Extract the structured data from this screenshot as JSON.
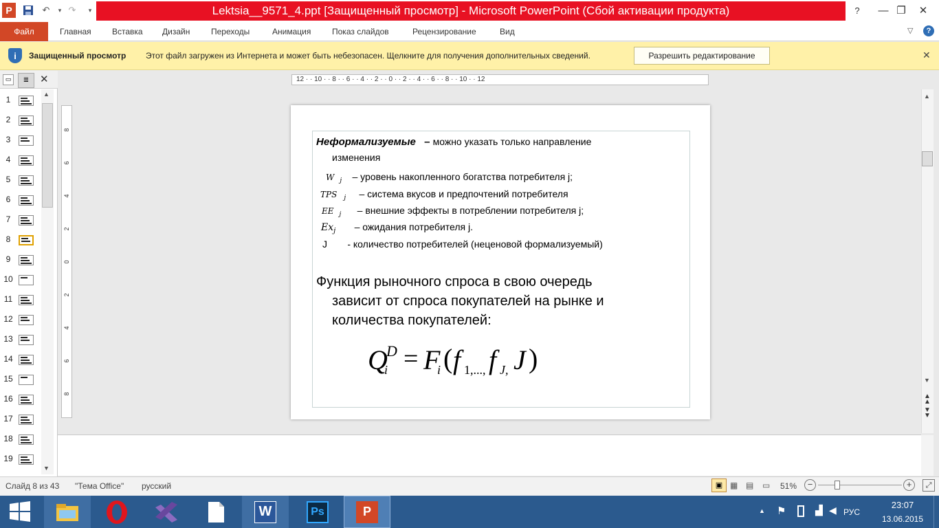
{
  "window": {
    "title": "Lektsia__9571_4.ppt [Защищенный просмотр] - Microsoft PowerPoint (Сбой активации продукта)",
    "app_icon": "P"
  },
  "ribbon": {
    "file_tab": "Файл",
    "tabs": [
      "Главная",
      "Вставка",
      "Дизайн",
      "Переходы",
      "Анимация",
      "Показ слайдов",
      "Рецензирование",
      "Вид"
    ]
  },
  "protected": {
    "title": "Защищенный просмотр",
    "message": "Этот файл загружен из Интернета и может быть небезопасен. Щелкните для получения дополнительных сведений.",
    "button": "Разрешить редактирование"
  },
  "thumbnails": [
    "1",
    "2",
    "3",
    "4",
    "5",
    "6",
    "7",
    "8",
    "9",
    "10",
    "11",
    "12",
    "13",
    "14",
    "15",
    "16",
    "17",
    "18",
    "19"
  ],
  "ruler": {
    "horizontal": "12 · · 10 · · 8 · · 6 · · 4 · · 2 · · 0 · · 2 · · 4 · · 6 · · 8 · · 10 · · 12",
    "vertical": [
      "8",
      "6",
      "4",
      "2",
      "0",
      "2",
      "4",
      "6",
      "8"
    ]
  },
  "slide": {
    "heading_bold": "Неформализуемые",
    "heading_dash": "–",
    "heading_rest": "можно указать только направление",
    "heading_cont": "изменения",
    "items": [
      {
        "sym": "W",
        "sub": "j",
        "text": "–  уровень  накопленного  богатства  потребителя  j;"
      },
      {
        "sym": "TPS",
        "sub": "j",
        "text": "– система  вкусов и предпочтений  потребителя"
      },
      {
        "sym": "EE",
        "sub": "j",
        "text": "– внешние  эффекты  в потреблении  потребителя  j;"
      },
      {
        "sym": "Ex",
        "sub": "j",
        "text": "– ожидания  потребителя  j."
      },
      {
        "sym": "J",
        "sub": "",
        "text": "- количество потребителей  (неценовой  формализуемый)"
      }
    ],
    "para_line1": "Функция рыночного спроса в свою очередь",
    "para_line2": "зависит от спроса покупателей на рынке и",
    "para_line3": "количества покупателей:",
    "formula": {
      "Q": "Q",
      "Q_sup": "D",
      "Q_sub": "i",
      "eq": "=",
      "F": "F",
      "F_sub": "i",
      "open": "(",
      "f1": "f",
      "f1_sub": "1,...,",
      "fJ": "f",
      "fJ_sub": "J,",
      "J": "J",
      "close": ")"
    }
  },
  "status": {
    "slide": "Слайд 8 из 43",
    "theme": "\"Тема Office\"",
    "language": "русский",
    "zoom": "51%",
    "zoom_level": 0.51
  },
  "taskbar": {
    "apps": [
      "start-icon",
      "file-explorer-icon",
      "opera-icon",
      "visual-studio-icon",
      "document-icon",
      "word-icon",
      "photoshop-icon",
      "powerpoint-icon"
    ],
    "language": "РУС",
    "time": "23:07",
    "date": "13.06.2015"
  },
  "colors": {
    "title_red": "#e81123",
    "file_tab": "#d24726",
    "protected_bar": "#fff1a8",
    "taskbar": "#2b5a8e"
  }
}
